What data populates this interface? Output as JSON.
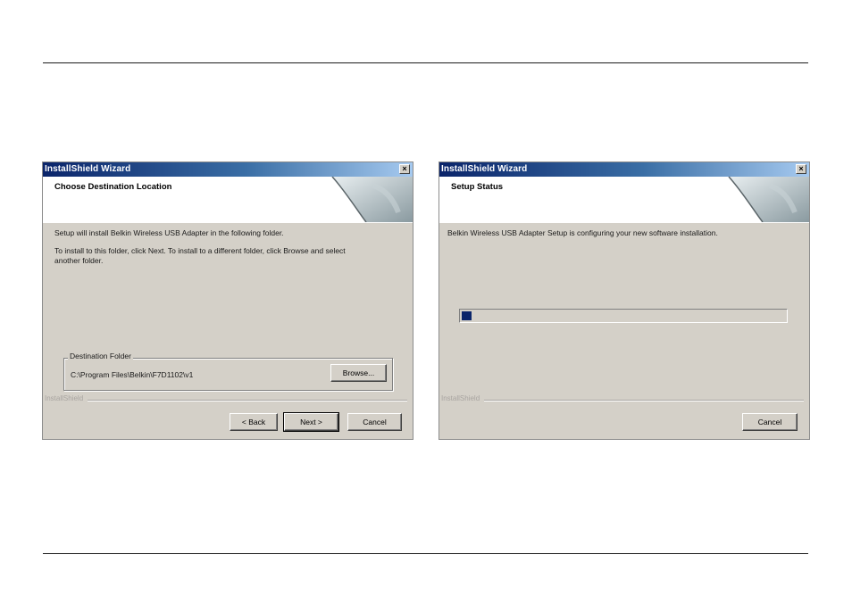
{
  "dialogs": [
    {
      "title": "InstallShield Wizard",
      "close": "×",
      "heading": "Choose Destination Location",
      "line1": "Setup will install Belkin Wireless USB Adapter in the following folder.",
      "line2": "To install to this folder, click Next. To install to a different folder, click Browse and select",
      "line3": "another folder.",
      "group_label": "Destination Folder",
      "path": "C:\\Program Files\\Belkin\\F7D1102\\v1",
      "browse": "Browse...",
      "brand": "InstallShield",
      "back": "< Back",
      "next": "Next >",
      "cancel": "Cancel"
    },
    {
      "title": "InstallShield Wizard",
      "close": "×",
      "heading": "Setup Status",
      "line1": "Belkin Wireless USB Adapter Setup is configuring your new software installation.",
      "brand": "InstallShield",
      "cancel": "Cancel",
      "progress_fraction": 0.03
    }
  ],
  "colors": {
    "titlebar_start": "#0a246a",
    "titlebar_end": "#a6caf0",
    "dialog_face": "#d4d0c8",
    "progress_fill": "#0a246a"
  }
}
